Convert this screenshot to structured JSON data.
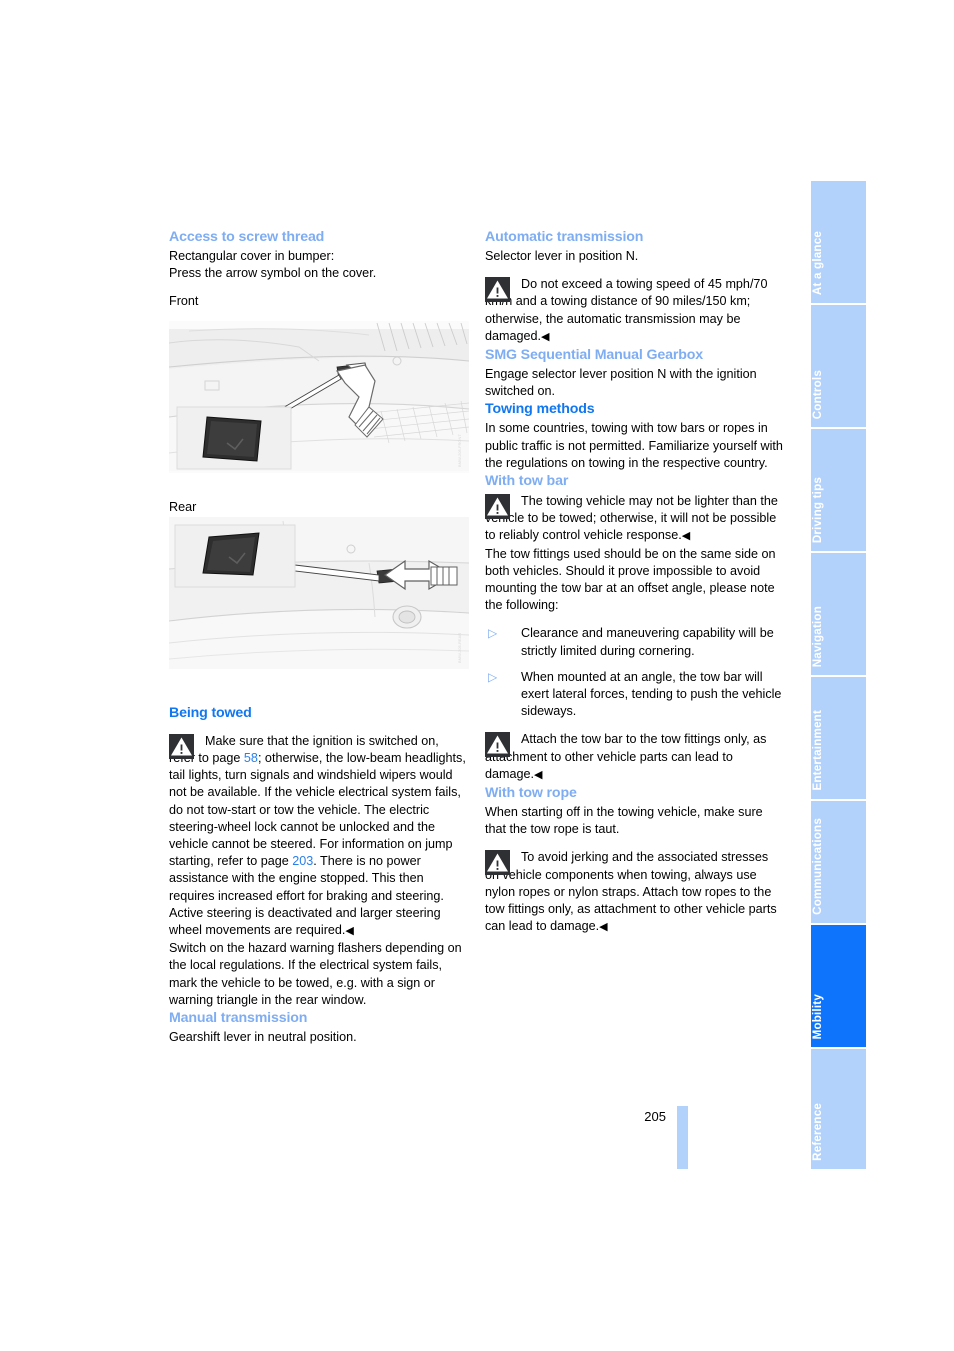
{
  "page": {
    "number": "205",
    "accent_light": "#7fadf2",
    "accent_dark": "#1177ee",
    "tab_light": "#b3d2fb",
    "tab_active": "#0e74fb"
  },
  "tabs": [
    {
      "label": "At a glance",
      "active": false
    },
    {
      "label": "Controls",
      "active": false
    },
    {
      "label": "Driving tips",
      "active": false
    },
    {
      "label": "Navigation",
      "active": false
    },
    {
      "label": "Entertainment",
      "active": false
    },
    {
      "label": "Communications",
      "active": false
    },
    {
      "label": "Mobility",
      "active": true
    },
    {
      "label": "Reference",
      "active": false
    }
  ],
  "left_column": {
    "h_access": "Access to screw thread",
    "p_access": "Rectangular cover in bumper:\nPress the arrow symbol on the cover.",
    "label_front": "Front",
    "label_rear": "Rear",
    "fig_front_id": "EWS-IMG-2-1",
    "fig_rear_id": "EWS-IMG-2-2",
    "h_being_towed": "Being towed",
    "warn_towed_pre": "Make sure that the ignition is switched on, refer to page ",
    "warn_towed_ref1": "58",
    "warn_towed_mid": "; otherwise, the low-beam headlights, tail lights, turn signals and windshield wipers would not be available. If the vehicle electrical system fails, do not tow-start or tow the vehicle. The electric steering-wheel lock cannot be unlocked and the vehicle cannot be steered. For information on jump starting, refer to page ",
    "warn_towed_ref2": "203",
    "warn_towed_post": ". There is no power assistance with the engine stopped. This then requires increased effort for braking and steering. Active steering is deactivated and larger steering wheel movements are required.",
    "p_hazard": "Switch on the hazard warning flashers depending on the local regulations. If the electrical system fails, mark the vehicle to be towed, e.g. with a sign or warning triangle in the rear window.",
    "h_manual": "Manual transmission",
    "p_manual": "Gearshift lever in neutral position."
  },
  "right_column": {
    "h_automatic": "Automatic transmission",
    "p_automatic": "Selector lever in position N.",
    "warn_automatic": "Do not exceed a towing speed of 45 mph/70 km/h and a towing distance of 90 miles/150 km; otherwise, the automatic transmission may be damaged.",
    "h_smg": "SMG Sequential Manual Gearbox",
    "p_smg": "Engage selector lever position N with the ignition switched on.",
    "h_towing_methods": "Towing methods",
    "p_towing_methods": "In some countries, towing with tow bars or ropes in public traffic is not permitted. Familiarize yourself with the regulations on towing in the respective country.",
    "h_tow_bar": "With tow bar",
    "warn_tow_bar": "The towing vehicle may not be lighter than the vehicle to be towed; otherwise, it will not be possible to reliably control vehicle response.",
    "p_tow_fittings": "The tow fittings used should be on the same side on both vehicles. Should it prove impossible to avoid mounting the tow bar at an offset angle, please note the following:",
    "bullets": [
      "Clearance and maneuvering capability will be strictly limited during cornering.",
      "When mounted at an angle, the tow bar will exert lateral forces, tending to push the vehicle sideways."
    ],
    "warn_attach": "Attach the tow bar to the tow fittings only, as attachment to other vehicle parts can lead to damage.",
    "h_tow_rope": "With tow rope",
    "p_tow_rope": "When starting off in the towing vehicle, make sure that the tow rope is taut.",
    "warn_tow_rope": "To avoid jerking and the associated stresses on vehicle components when towing, always use nylon ropes or nylon straps. Attach tow ropes to the tow fittings only, as attachment to other vehicle parts can lead to damage."
  },
  "glyphs": {
    "end_mark": "◀",
    "bullet_mark": "▷"
  }
}
